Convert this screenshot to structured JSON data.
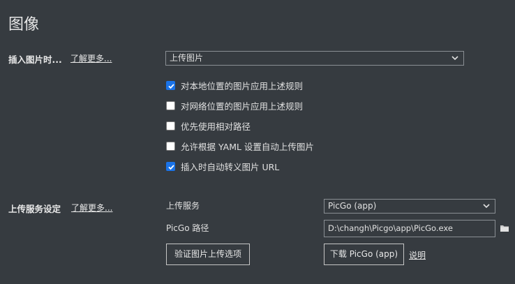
{
  "page": {
    "title": "图像"
  },
  "insert_section": {
    "label": "插入图片时...",
    "learn_more": "了解更多...",
    "action_select": {
      "value": "上传图片"
    },
    "options": [
      {
        "label": "对本地位置的图片应用上述规则",
        "checked": true
      },
      {
        "label": "对网络位置的图片应用上述规则",
        "checked": false
      },
      {
        "label": "优先使用相对路径",
        "checked": false
      },
      {
        "label": "允许根据 YAML 设置自动上传图片",
        "checked": false
      },
      {
        "label": "插入时自动转义图片 URL",
        "checked": true
      }
    ]
  },
  "upload_section": {
    "label": "上传服务设定",
    "learn_more": "了解更多...",
    "service_label": "上传服务",
    "service_select": {
      "value": "PicGo (app)"
    },
    "path_label": "PicGo 路径",
    "path_value": "D:\\changh\\Picgo\\app\\PicGo.exe",
    "verify_button": "验证图片上传选项",
    "download_button": "下载 PicGo (app)",
    "explain_link": "说明"
  },
  "icons": {
    "chevron": "chevron-down-icon",
    "folder": "folder-icon",
    "check": "check-icon"
  },
  "colors": {
    "background": "#363b40",
    "checkbox_checked": "#1a73e8"
  }
}
